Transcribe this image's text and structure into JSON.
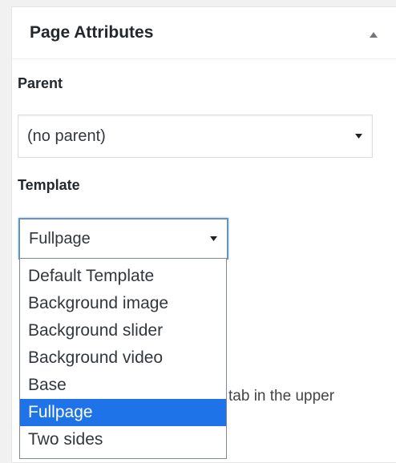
{
  "panel": {
    "title": "Page Attributes",
    "collapse_icon": "triangle-up-icon"
  },
  "parent": {
    "label": "Parent",
    "selected": "(no parent)"
  },
  "template": {
    "label": "Template",
    "selected": "Fullpage",
    "options": [
      "Default Template",
      "Background image",
      "Background slider",
      "Background video",
      "Base",
      "Fullpage",
      "Two sides"
    ],
    "highlighted_index": 5
  },
  "help": {
    "partial_text": "tab in the upper"
  },
  "colors": {
    "highlight": "#1e73e8",
    "focus_ring": "#5b9dd9"
  }
}
